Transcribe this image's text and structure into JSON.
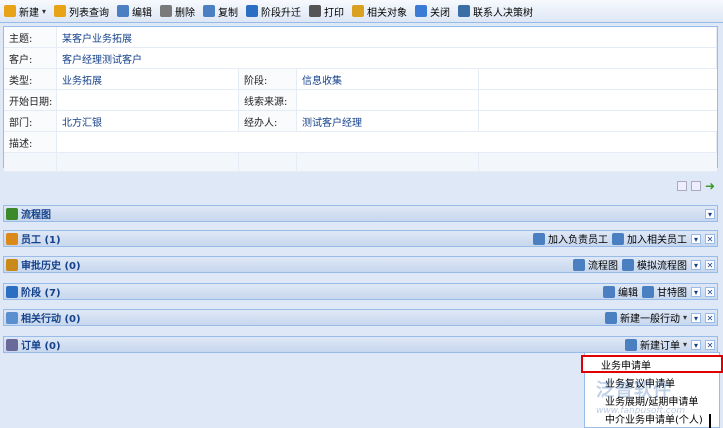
{
  "toolbar": {
    "items": [
      {
        "label": "新建",
        "icon": "new-icon",
        "color": "#e8a317",
        "has_arrow": true
      },
      {
        "label": "列表查询",
        "icon": "list-query-icon",
        "color": "#e8a317"
      },
      {
        "label": "编辑",
        "icon": "edit-icon",
        "color": "#4a7fc1"
      },
      {
        "label": "删除",
        "icon": "delete-icon",
        "color": "#7a7a7a"
      },
      {
        "label": "复制",
        "icon": "copy-icon",
        "color": "#4a7fc1"
      },
      {
        "label": "阶段升迁",
        "icon": "stage-icon",
        "color": "#2b6fc2"
      },
      {
        "label": "打印",
        "icon": "print-icon",
        "color": "#555555"
      },
      {
        "label": "相关对象",
        "icon": "related-object-icon",
        "color": "#d9a021"
      },
      {
        "label": "关闭",
        "icon": "close-icon",
        "color": "#3a7bd5"
      },
      {
        "label": "联系人决策树",
        "icon": "contact-tree-icon",
        "color": "#3a6ea5"
      }
    ]
  },
  "form": {
    "subject_label": "主题:",
    "subject": "某客户业务拓展",
    "customer_label": "客户:",
    "customer": "客户经理测试客户",
    "type_label": "类型:",
    "type": "业务拓展",
    "stage_label": "阶段:",
    "stage": "信息收集",
    "start_label": "开始日期:",
    "start": "",
    "lead_label": "线索来源:",
    "lead": "",
    "dept_label": "部门:",
    "dept": "北方汇银",
    "handler_label": "经办人:",
    "handler": "测试客户经理",
    "desc_label": "描述:",
    "desc": ""
  },
  "sections": [
    {
      "key": "flow",
      "title": "流程图",
      "icon": "flowchart-icon",
      "color": "#3a8a2a",
      "actions": [],
      "has_close": false
    },
    {
      "key": "staff",
      "title": "员工 (1)",
      "icon": "staff-icon",
      "color": "#d98a1a",
      "actions": [
        {
          "label": "加入负责员工",
          "icon": "add-owner-icon"
        },
        {
          "label": "加入相关员工",
          "icon": "add-member-icon"
        }
      ],
      "has_close": true
    },
    {
      "key": "approval",
      "title": "审批历史 (0)",
      "icon": "approval-icon",
      "color": "#c98a1a",
      "actions": [
        {
          "label": "流程图",
          "icon": "flow-icon"
        },
        {
          "label": "模拟流程图",
          "icon": "sim-flow-icon"
        }
      ],
      "has_close": true
    },
    {
      "key": "stage",
      "title": "阶段 (7)",
      "icon": "stage-bars-icon",
      "color": "#2b6fc2",
      "actions": [
        {
          "label": "编辑",
          "icon": "edit-icon"
        },
        {
          "label": "甘特图",
          "icon": "gantt-icon"
        }
      ],
      "has_close": true
    },
    {
      "key": "actions",
      "title": "相关行动 (0)",
      "icon": "action-icon",
      "color": "#5a8fd0",
      "actions": [
        {
          "label": "新建一般行动",
          "icon": "new-action-icon",
          "arrow": true
        }
      ],
      "has_close": true
    },
    {
      "key": "orders",
      "title": "订单 (0)",
      "icon": "order-icon",
      "color": "#6a6a9a",
      "actions": [
        {
          "label": "新建订单",
          "icon": "new-order-icon",
          "arrow": true
        }
      ],
      "has_close": true
    }
  ],
  "dropdown": {
    "items": [
      "业务申请单",
      "业务复议申请单",
      "业务展期/延期申请单",
      "中介业务申请单(个人)"
    ]
  },
  "watermark": "泛普软件",
  "watermark_url": "www.fanpusoft.com"
}
